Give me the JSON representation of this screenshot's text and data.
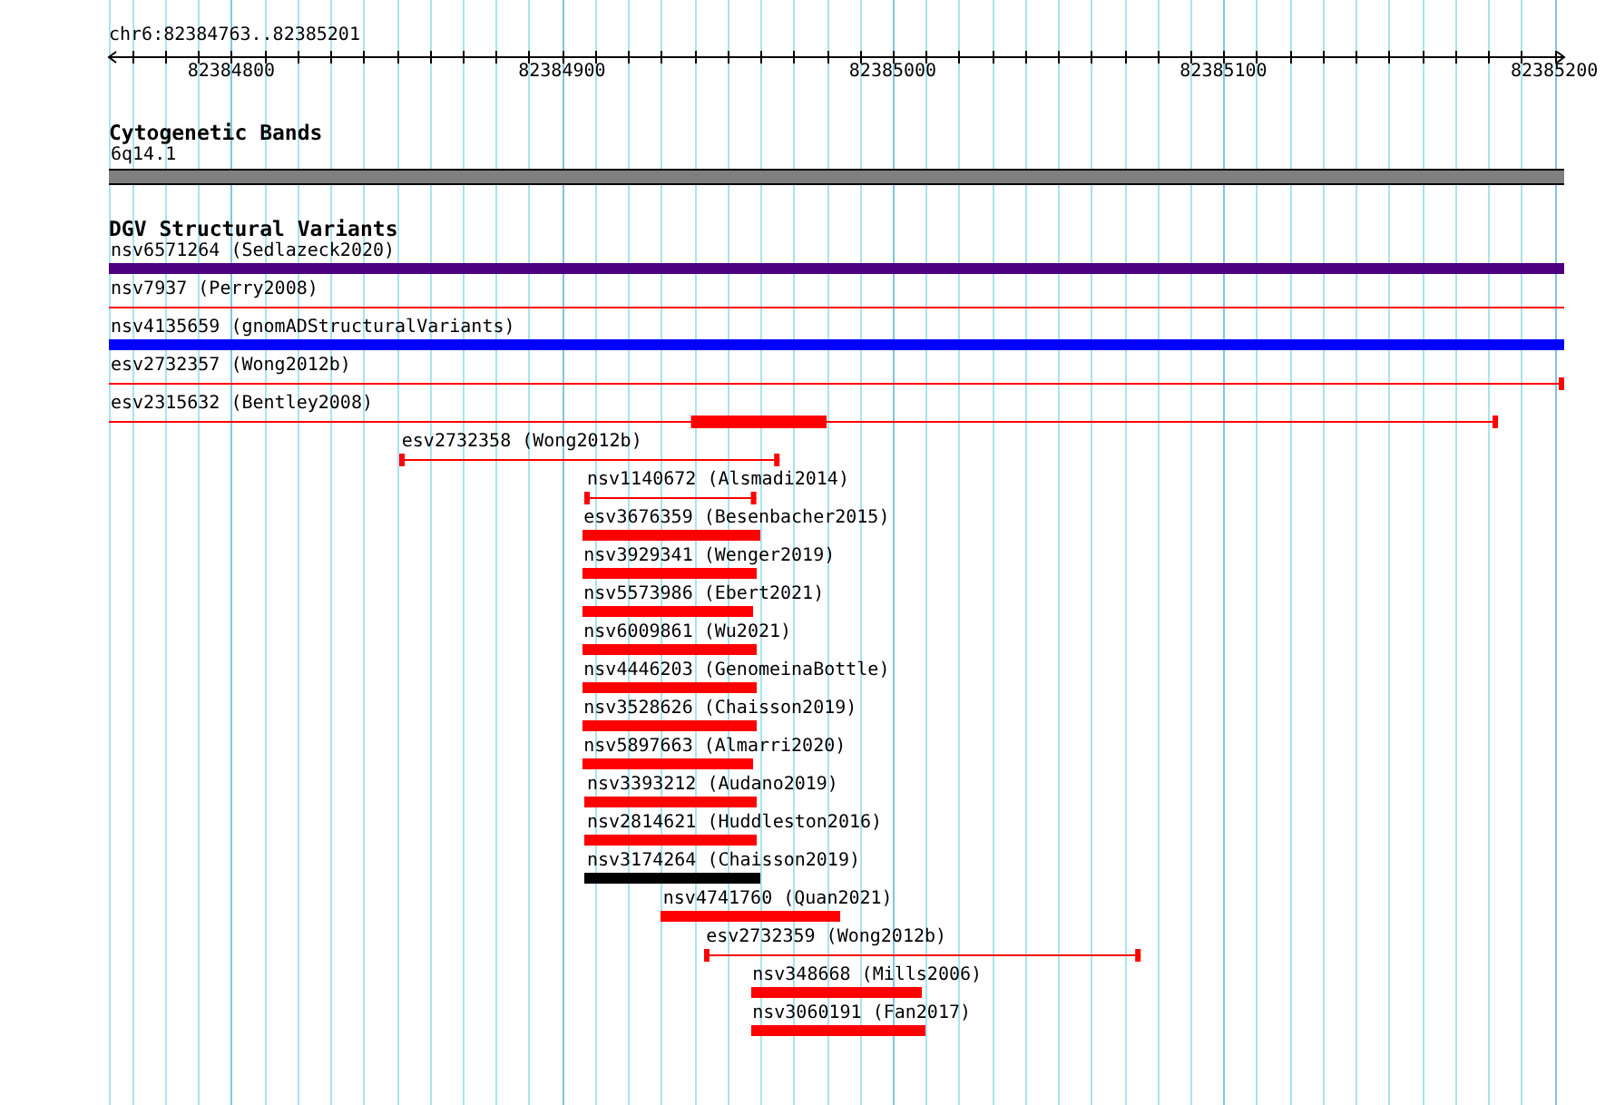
{
  "ruler": {
    "title": "chr6:82384763..82385201",
    "ticks": [
      {
        "label": "82384800"
      },
      {
        "label": "82384900"
      },
      {
        "label": "82385000"
      },
      {
        "label": "82385100"
      },
      {
        "label": "82385200"
      }
    ]
  },
  "tracks": [
    {
      "title": "Cytogenetic Bands",
      "kind": "bands",
      "features": [
        {
          "label": "6q14.1",
          "kind": "band",
          "color": "#808080"
        }
      ]
    },
    {
      "title": "DGV Structural Variants",
      "kind": "variants",
      "features": [
        {
          "label": "nsv6571264 (Sedlazeck2020)",
          "kind": "block",
          "color": "#4b0082"
        },
        {
          "label": "nsv7937 (Perry2008)",
          "kind": "line",
          "start_cap": false,
          "end_cap": false,
          "color": "#ff0000"
        },
        {
          "label": "nsv4135659 (gnomADStructuralVariants)",
          "kind": "block",
          "color": "#0000ff"
        },
        {
          "label": "esv2732357 (Wong2012b)",
          "kind": "line",
          "start_cap": false,
          "end_cap": true,
          "color": "#ff0000"
        },
        {
          "label": "esv2315632 (Bentley2008)",
          "kind": "line",
          "start_cap": false,
          "end_cap": true,
          "color": "#ff0000"
        },
        {
          "label": "esv2732358 (Wong2012b)",
          "kind": "line",
          "start_cap": true,
          "end_cap": true,
          "color": "#ff0000"
        },
        {
          "label": "nsv1140672 (Alsmadi2014)",
          "kind": "line",
          "start_cap": true,
          "end_cap": true,
          "color": "#ff0000"
        },
        {
          "label": "esv3676359 (Besenbacher2015)",
          "kind": "block",
          "color": "#ff0000"
        },
        {
          "label": "nsv3929341 (Wenger2019)",
          "kind": "block",
          "color": "#ff0000"
        },
        {
          "label": "nsv5573986 (Ebert2021)",
          "kind": "block",
          "color": "#ff0000"
        },
        {
          "label": "nsv6009861 (Wu2021)",
          "kind": "block",
          "color": "#ff0000"
        },
        {
          "label": "nsv4446203 (GenomeinaBottle)",
          "kind": "block",
          "color": "#ff0000"
        },
        {
          "label": "nsv3528626 (Chaisson2019)",
          "kind": "block",
          "color": "#ff0000"
        },
        {
          "label": "nsv5897663 (Almarri2020)",
          "kind": "block",
          "color": "#ff0000"
        },
        {
          "label": "nsv3393212 (Audano2019)",
          "kind": "block",
          "color": "#ff0000"
        },
        {
          "label": "nsv2814621 (Huddleston2016)",
          "kind": "block",
          "color": "#ff0000"
        },
        {
          "label": "nsv3174264 (Chaisson2019)",
          "kind": "block",
          "color": "#000000"
        },
        {
          "label": "nsv4741760 (Quan2021)",
          "kind": "block",
          "color": "#ff0000"
        },
        {
          "label": "esv2732359 (Wong2012b)",
          "kind": "line",
          "start_cap": true,
          "end_cap": true,
          "color": "#ff0000"
        },
        {
          "label": "nsv348668 (Mills2006)",
          "kind": "block",
          "color": "#ff0000"
        },
        {
          "label": "nsv3060191 (Fan2017)",
          "kind": "block",
          "color": "#ff0000"
        }
      ]
    }
  ]
}
